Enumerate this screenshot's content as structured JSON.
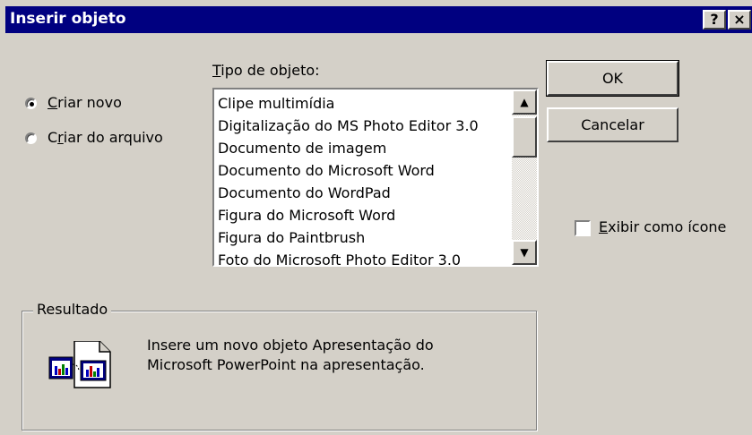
{
  "window": {
    "title": "Inserir objeto",
    "help_button": "?",
    "close_button": "×"
  },
  "options": {
    "criar_novo": {
      "prefix": "",
      "accel": "C",
      "rest": "riar novo",
      "checked": true
    },
    "criar_arquivo": {
      "prefix": "C",
      "accel": "r",
      "rest": "iar do arquivo",
      "checked": false
    }
  },
  "object_type": {
    "label_accel": "T",
    "label_rest": "ipo de objeto:",
    "items": [
      "Clipe multimídia",
      "Digitalização do MS Photo Editor 3.0",
      "Documento de imagem",
      "Documento do Microsoft Word",
      "Documento do WordPad",
      "Figura do Microsoft Word",
      "Figura do Paintbrush",
      "Foto do Microsoft Photo Editor 3.0"
    ]
  },
  "buttons": {
    "ok": "OK",
    "cancel": "Cancelar"
  },
  "display_icon": {
    "accel": "E",
    "rest": "xibir como ícone",
    "checked": false
  },
  "result": {
    "legend": "Resultado",
    "line1": "Insere um novo objeto Apresentação do",
    "line2": "Microsoft PowerPoint na apresentação."
  }
}
